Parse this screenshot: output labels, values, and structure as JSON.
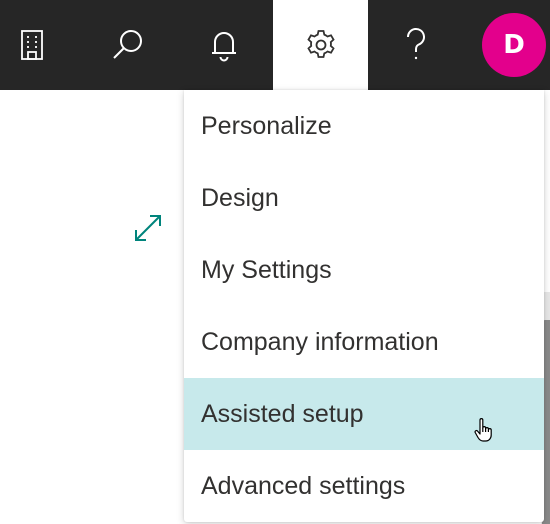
{
  "topbar": {
    "buttons": [
      {
        "icon": "building-icon"
      },
      {
        "icon": "search-icon"
      },
      {
        "icon": "bell-icon"
      },
      {
        "icon": "gear-icon",
        "active": true
      },
      {
        "icon": "help-icon"
      }
    ],
    "avatar": {
      "initial": "D",
      "color": "#e3008c"
    }
  },
  "settings_menu": {
    "items": [
      {
        "label": "Personalize"
      },
      {
        "label": "Design"
      },
      {
        "label": "My Settings"
      },
      {
        "label": "Company information"
      },
      {
        "label": "Assisted setup",
        "highlighted": true
      },
      {
        "label": "Advanced settings"
      }
    ]
  },
  "colors": {
    "topbar": "#262626",
    "highlight": "#c7e9eb",
    "accent_teal": "#00847c",
    "avatar": "#e3008c"
  }
}
